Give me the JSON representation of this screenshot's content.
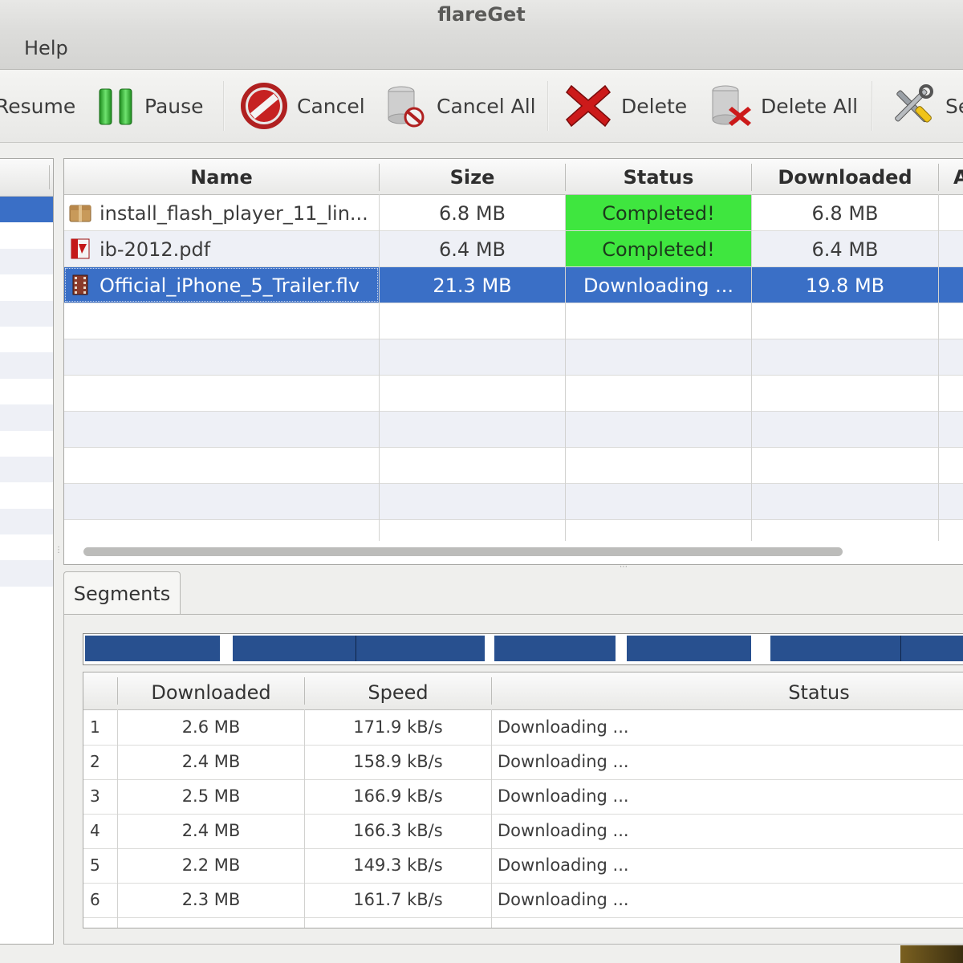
{
  "window": {
    "title": "flareGet"
  },
  "menu": {
    "items": [
      "Help"
    ]
  },
  "toolbar": {
    "resume": "Resume",
    "pause": "Pause",
    "cancel": "Cancel",
    "cancel_all": "Cancel All",
    "delete": "Delete",
    "delete_all": "Delete All",
    "settings": "Se"
  },
  "downloads": {
    "columns": [
      "Name",
      "Size",
      "Status",
      "Downloaded",
      "A"
    ],
    "rows": [
      {
        "name": "install_flash_player_11_lin...",
        "size": "6.8 MB",
        "status": "Completed!",
        "downloaded": "6.8 MB",
        "icon": "package-icon"
      },
      {
        "name": "ib-2012.pdf",
        "size": "6.4 MB",
        "status": "Completed!",
        "downloaded": "6.4 MB",
        "icon": "pdf-icon"
      },
      {
        "name": "Official_iPhone_5_Trailer.flv",
        "size": "21.3 MB",
        "status": "Downloading ...",
        "downloaded": "19.8 MB",
        "icon": "video-file-icon"
      }
    ]
  },
  "colors": {
    "completed": "#3fe63f",
    "selected": "#3a6fc6",
    "segment": "#28508f"
  },
  "segments": {
    "tab_label": "Segments",
    "columns": [
      "Downloaded",
      "Speed",
      "Status"
    ],
    "rows": [
      {
        "index": "1",
        "downloaded": "2.6 MB",
        "speed": "171.9 kB/s",
        "status": "Downloading ..."
      },
      {
        "index": "2",
        "downloaded": "2.4 MB",
        "speed": "158.9 kB/s",
        "status": "Downloading ..."
      },
      {
        "index": "3",
        "downloaded": "2.5 MB",
        "speed": "166.9 kB/s",
        "status": "Downloading ..."
      },
      {
        "index": "4",
        "downloaded": "2.4 MB",
        "speed": "166.3 kB/s",
        "status": "Downloading ..."
      },
      {
        "index": "5",
        "downloaded": "2.2 MB",
        "speed": "149.3 kB/s",
        "status": "Downloading ..."
      },
      {
        "index": "6",
        "downloaded": "2.3 MB",
        "speed": "161.7 kB/s",
        "status": "Downloading ..."
      }
    ]
  }
}
